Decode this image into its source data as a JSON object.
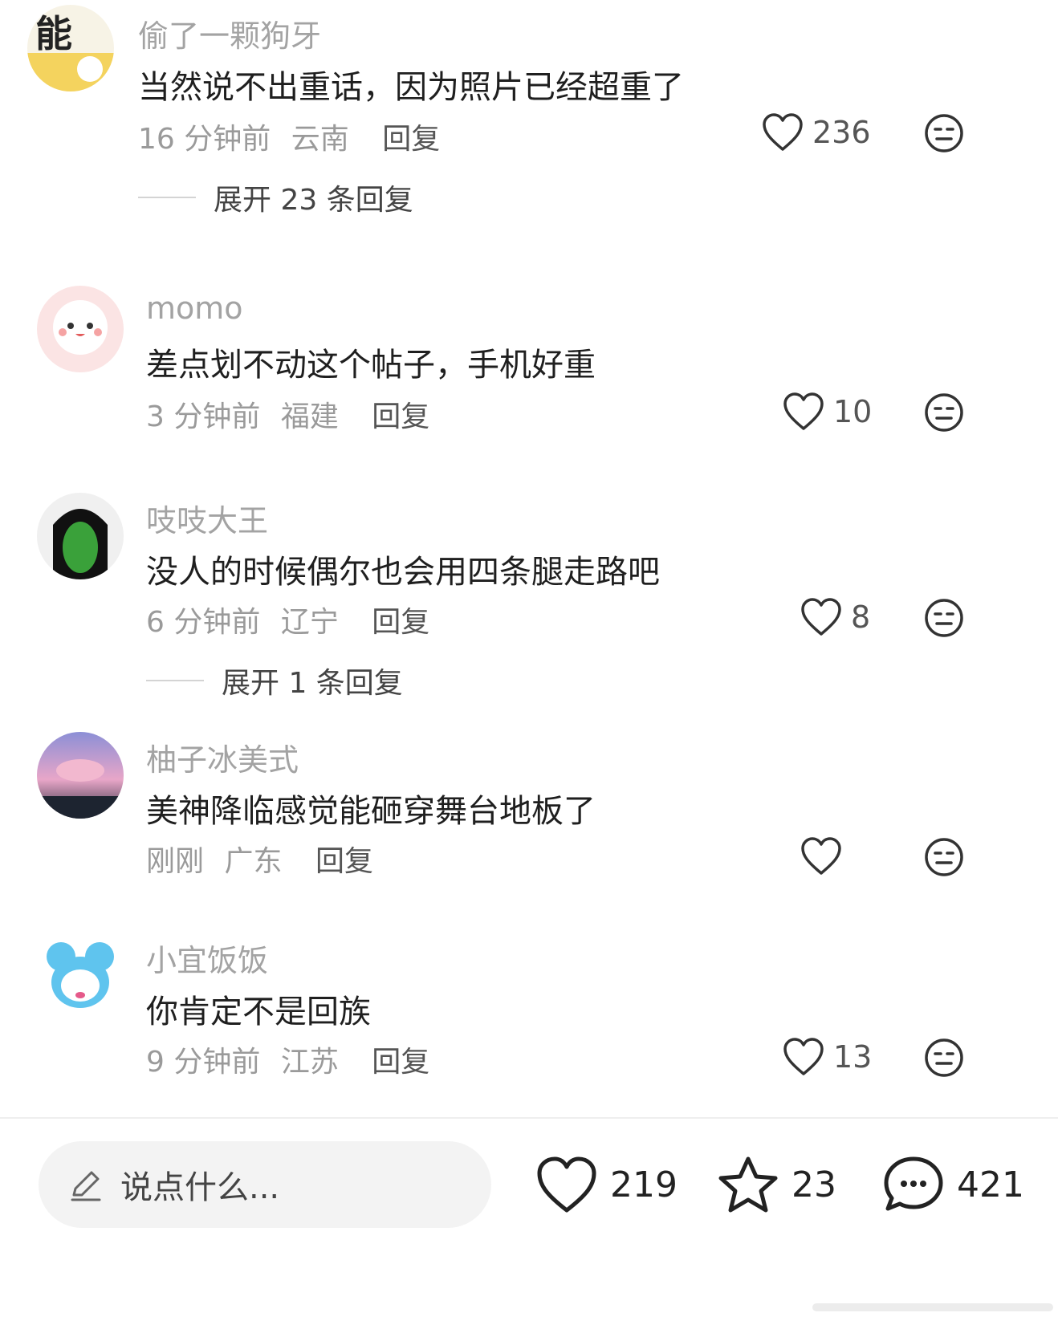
{
  "comments": [
    {
      "username": "偷了一颗狗牙",
      "text": "当然说不出重话，因为照片已经超重了",
      "time": "16 分钟前",
      "location": "云南",
      "reply": "回复",
      "likes": "236",
      "expand": "展开 23 条回复",
      "avatar_text": "能"
    },
    {
      "username": "momo",
      "text": "差点划不动这个帖子，手机好重",
      "time": "3 分钟前",
      "location": "福建",
      "reply": "回复",
      "likes": "10"
    },
    {
      "username": "吱吱大王",
      "text": "没人的时候偶尔也会用四条腿走路吧",
      "time": "6 分钟前",
      "location": "辽宁",
      "reply": "回复",
      "likes": "8",
      "expand": "展开 1 条回复"
    },
    {
      "username": "柚子冰美式",
      "text": "美神降临感觉能砸穿舞台地板了",
      "time": "刚刚",
      "location": "广东",
      "reply": "回复",
      "likes": ""
    },
    {
      "username": "小宜饭饭",
      "text": "你肯定不是回族",
      "time": "9 分钟前",
      "location": "江苏",
      "reply": "回复",
      "likes": "13"
    }
  ],
  "bottom_bar": {
    "placeholder": "说点什么...",
    "likes": "219",
    "favorites": "23",
    "comments": "421"
  },
  "icons": {
    "heart": "heart-icon",
    "dislike": "dislike-face-icon",
    "pen": "pen-icon",
    "star": "star-icon",
    "chat": "chat-bubble-icon"
  }
}
